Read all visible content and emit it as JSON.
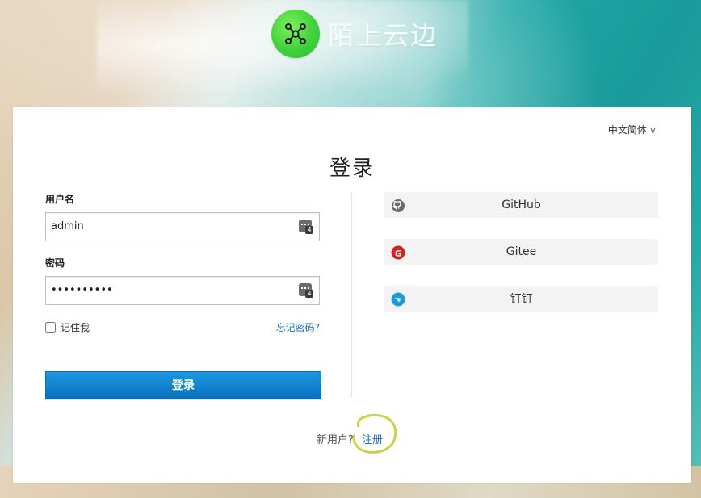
{
  "brand": {
    "title": "陌上云边"
  },
  "language": {
    "selected": "中文简体",
    "chevron": "v"
  },
  "login": {
    "title": "登录",
    "username_label": "用户名",
    "username_value": "admin",
    "password_label": "密码",
    "password_value": "••••••••••",
    "remember_label": "记住我",
    "forgot_label": "忘记密码?",
    "submit_label": "登录"
  },
  "social": {
    "items": [
      {
        "label": "GitHub",
        "icon": "github-icon"
      },
      {
        "label": "Gitee",
        "icon": "gitee-icon"
      },
      {
        "label": "钉钉",
        "icon": "dingtalk-icon"
      }
    ]
  },
  "register": {
    "prompt": "新用户?",
    "link": "注册"
  },
  "colors": {
    "primary": "#0a72bf",
    "link": "#1b6fb8",
    "logo_green": "#3fd13b",
    "gitee_red": "#d61f1f",
    "dingtalk_blue": "#1a9bd7",
    "annotation": "#c9d24a"
  }
}
